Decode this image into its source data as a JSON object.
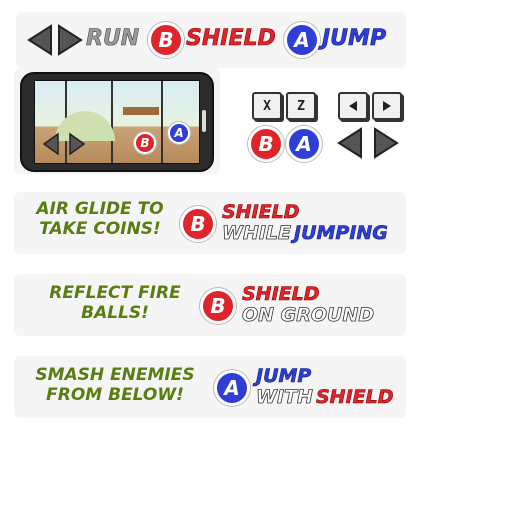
{
  "controls_row": {
    "run_label": "RUN",
    "shield_label": "SHIELD",
    "jump_label": "JUMP",
    "b_letter": "B",
    "a_letter": "A"
  },
  "mobile": {
    "b_letter": "B",
    "a_letter": "A"
  },
  "keyboard": {
    "key_x": "X",
    "key_z": "Z",
    "b_letter": "B",
    "a_letter": "A"
  },
  "tips": [
    {
      "text_line1": "AIR GLIDE TO",
      "text_line2": "TAKE COINS!",
      "button": "B",
      "action_line1": "SHIELD",
      "action_line2_a": "WHILE",
      "action_line2_b": "JUMPING"
    },
    {
      "text_line1": "REFLECT FIRE",
      "text_line2": "BALLS!",
      "button": "B",
      "action_line1": "SHIELD",
      "action_line2_a": "ON GROUND"
    },
    {
      "text_line1": "SMASH ENEMIES",
      "text_line2": "FROM BELOW!",
      "button": "A",
      "action_line1": "JUMP",
      "action_line2_a": "WITH",
      "action_line2_b": "SHIELD"
    }
  ],
  "colors": {
    "red": "#e0242b",
    "blue": "#2f3fd6",
    "olive": "#5a7d12",
    "grey": "#9a9a9a"
  }
}
